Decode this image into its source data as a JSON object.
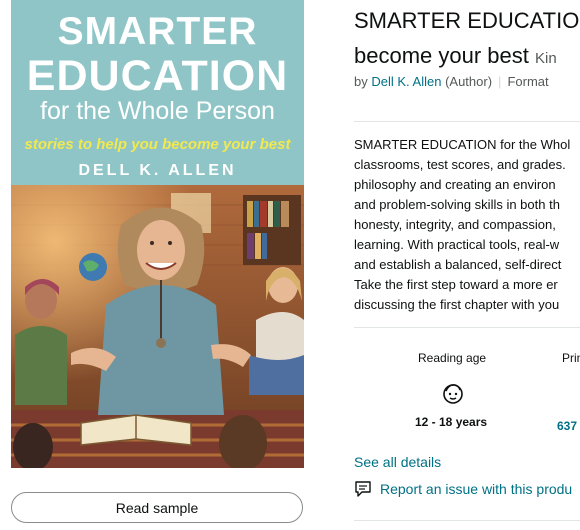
{
  "cover": {
    "title_top": "SMARTER",
    "title_mid": "EDUCATION",
    "subtitle": "for the Whole Person",
    "tagline": "stories to help you become your best",
    "author": "DELL K. ALLEN"
  },
  "read_sample_label": "Read sample",
  "product": {
    "title_line1": "SMARTER EDUCATIO",
    "title_line2": "become your best",
    "format_text": "Kin",
    "by_label": "by",
    "author_name": "Dell K. Allen",
    "author_role": "(Author)",
    "format_label": "Format"
  },
  "description": [
    "SMARTER EDUCATION for the Whol",
    "classrooms, test scores, and grades.",
    "philosophy and creating an environ",
    "and problem-solving skills in both th",
    "honesty, integrity, and compassion,",
    "learning. With practical tools, real-w",
    "and establish a balanced, self-direct",
    "Take the first step toward a more er",
    "discussing the first chapter with you"
  ],
  "attributes": {
    "reading_age_label": "Reading age",
    "reading_age_value": "12 - 18 years",
    "reading_age_icon": "child-face-icon",
    "print_label": "Prin",
    "print_value": "637"
  },
  "links": {
    "see_all": "See all details",
    "report": "Report an issue with this produ"
  },
  "colors": {
    "link": "#007185",
    "cover_teal": "#8fc5c7",
    "tagline_yellow": "#f2e94e"
  }
}
